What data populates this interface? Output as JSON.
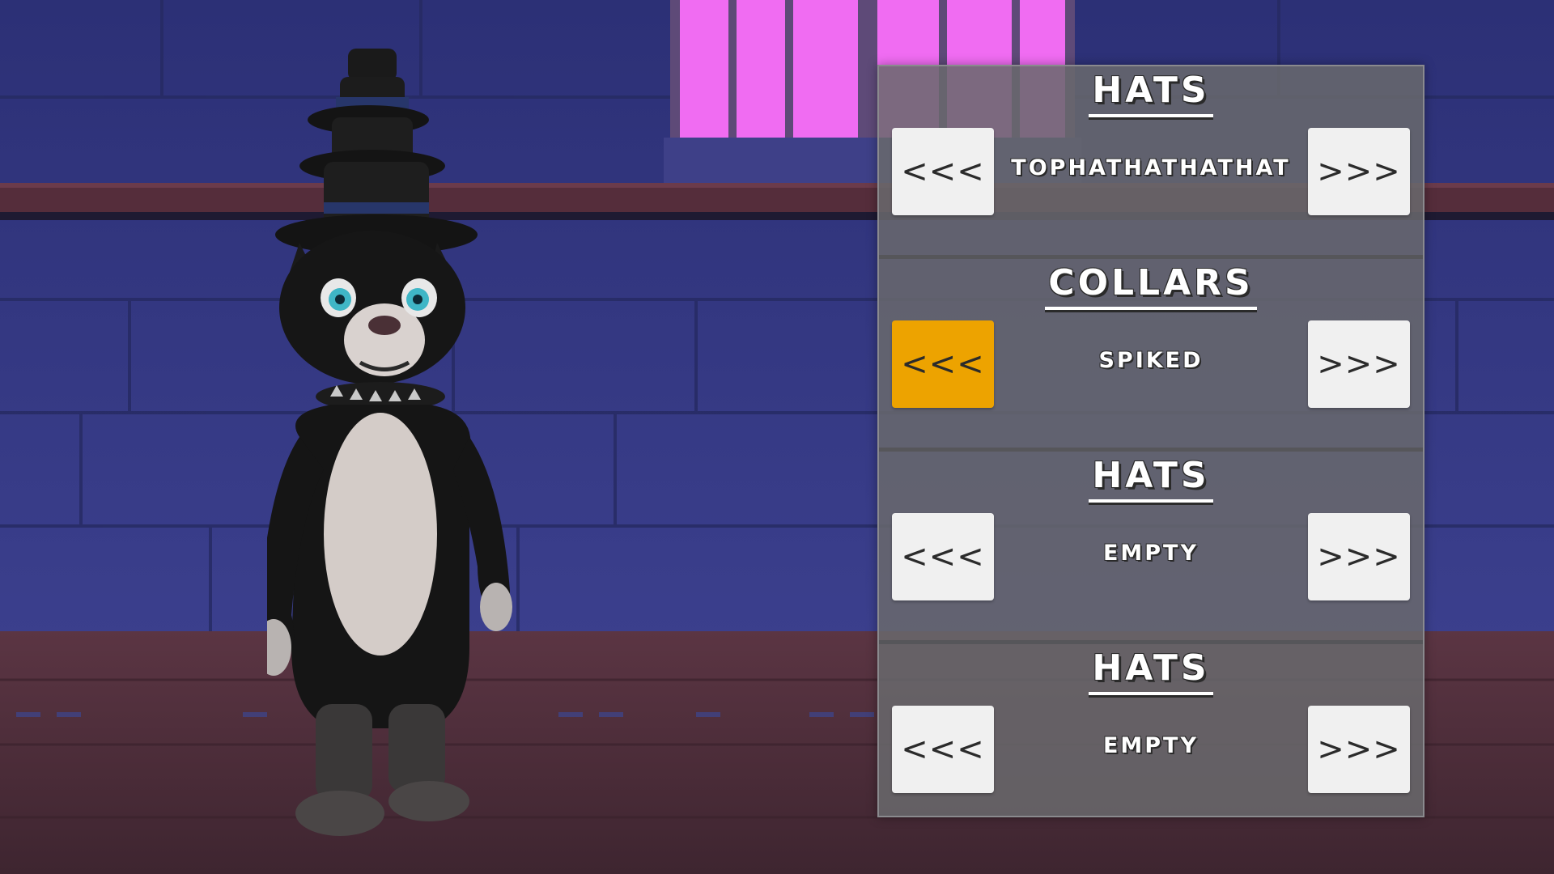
{
  "customizer": {
    "sections": [
      {
        "title": "HATS",
        "value": "TOPHATHATHATHAT",
        "prev_label": "<<<",
        "next_label": ">>>"
      },
      {
        "title": "COLLARS",
        "value": "SPIKED",
        "prev_label": "<<<",
        "next_label": ">>>"
      },
      {
        "title": "HATS",
        "value": "EMPTY",
        "prev_label": "<<<",
        "next_label": ">>>"
      },
      {
        "title": "HATS",
        "value": "EMPTY",
        "prev_label": "<<<",
        "next_label": ">>>"
      }
    ]
  },
  "colors": {
    "panel": "#69696c",
    "button": "#f0f0f0",
    "button_active": "#eda300",
    "wall": "#3a3f8e",
    "floor": "#5a3340",
    "window": "#f06cf2"
  }
}
